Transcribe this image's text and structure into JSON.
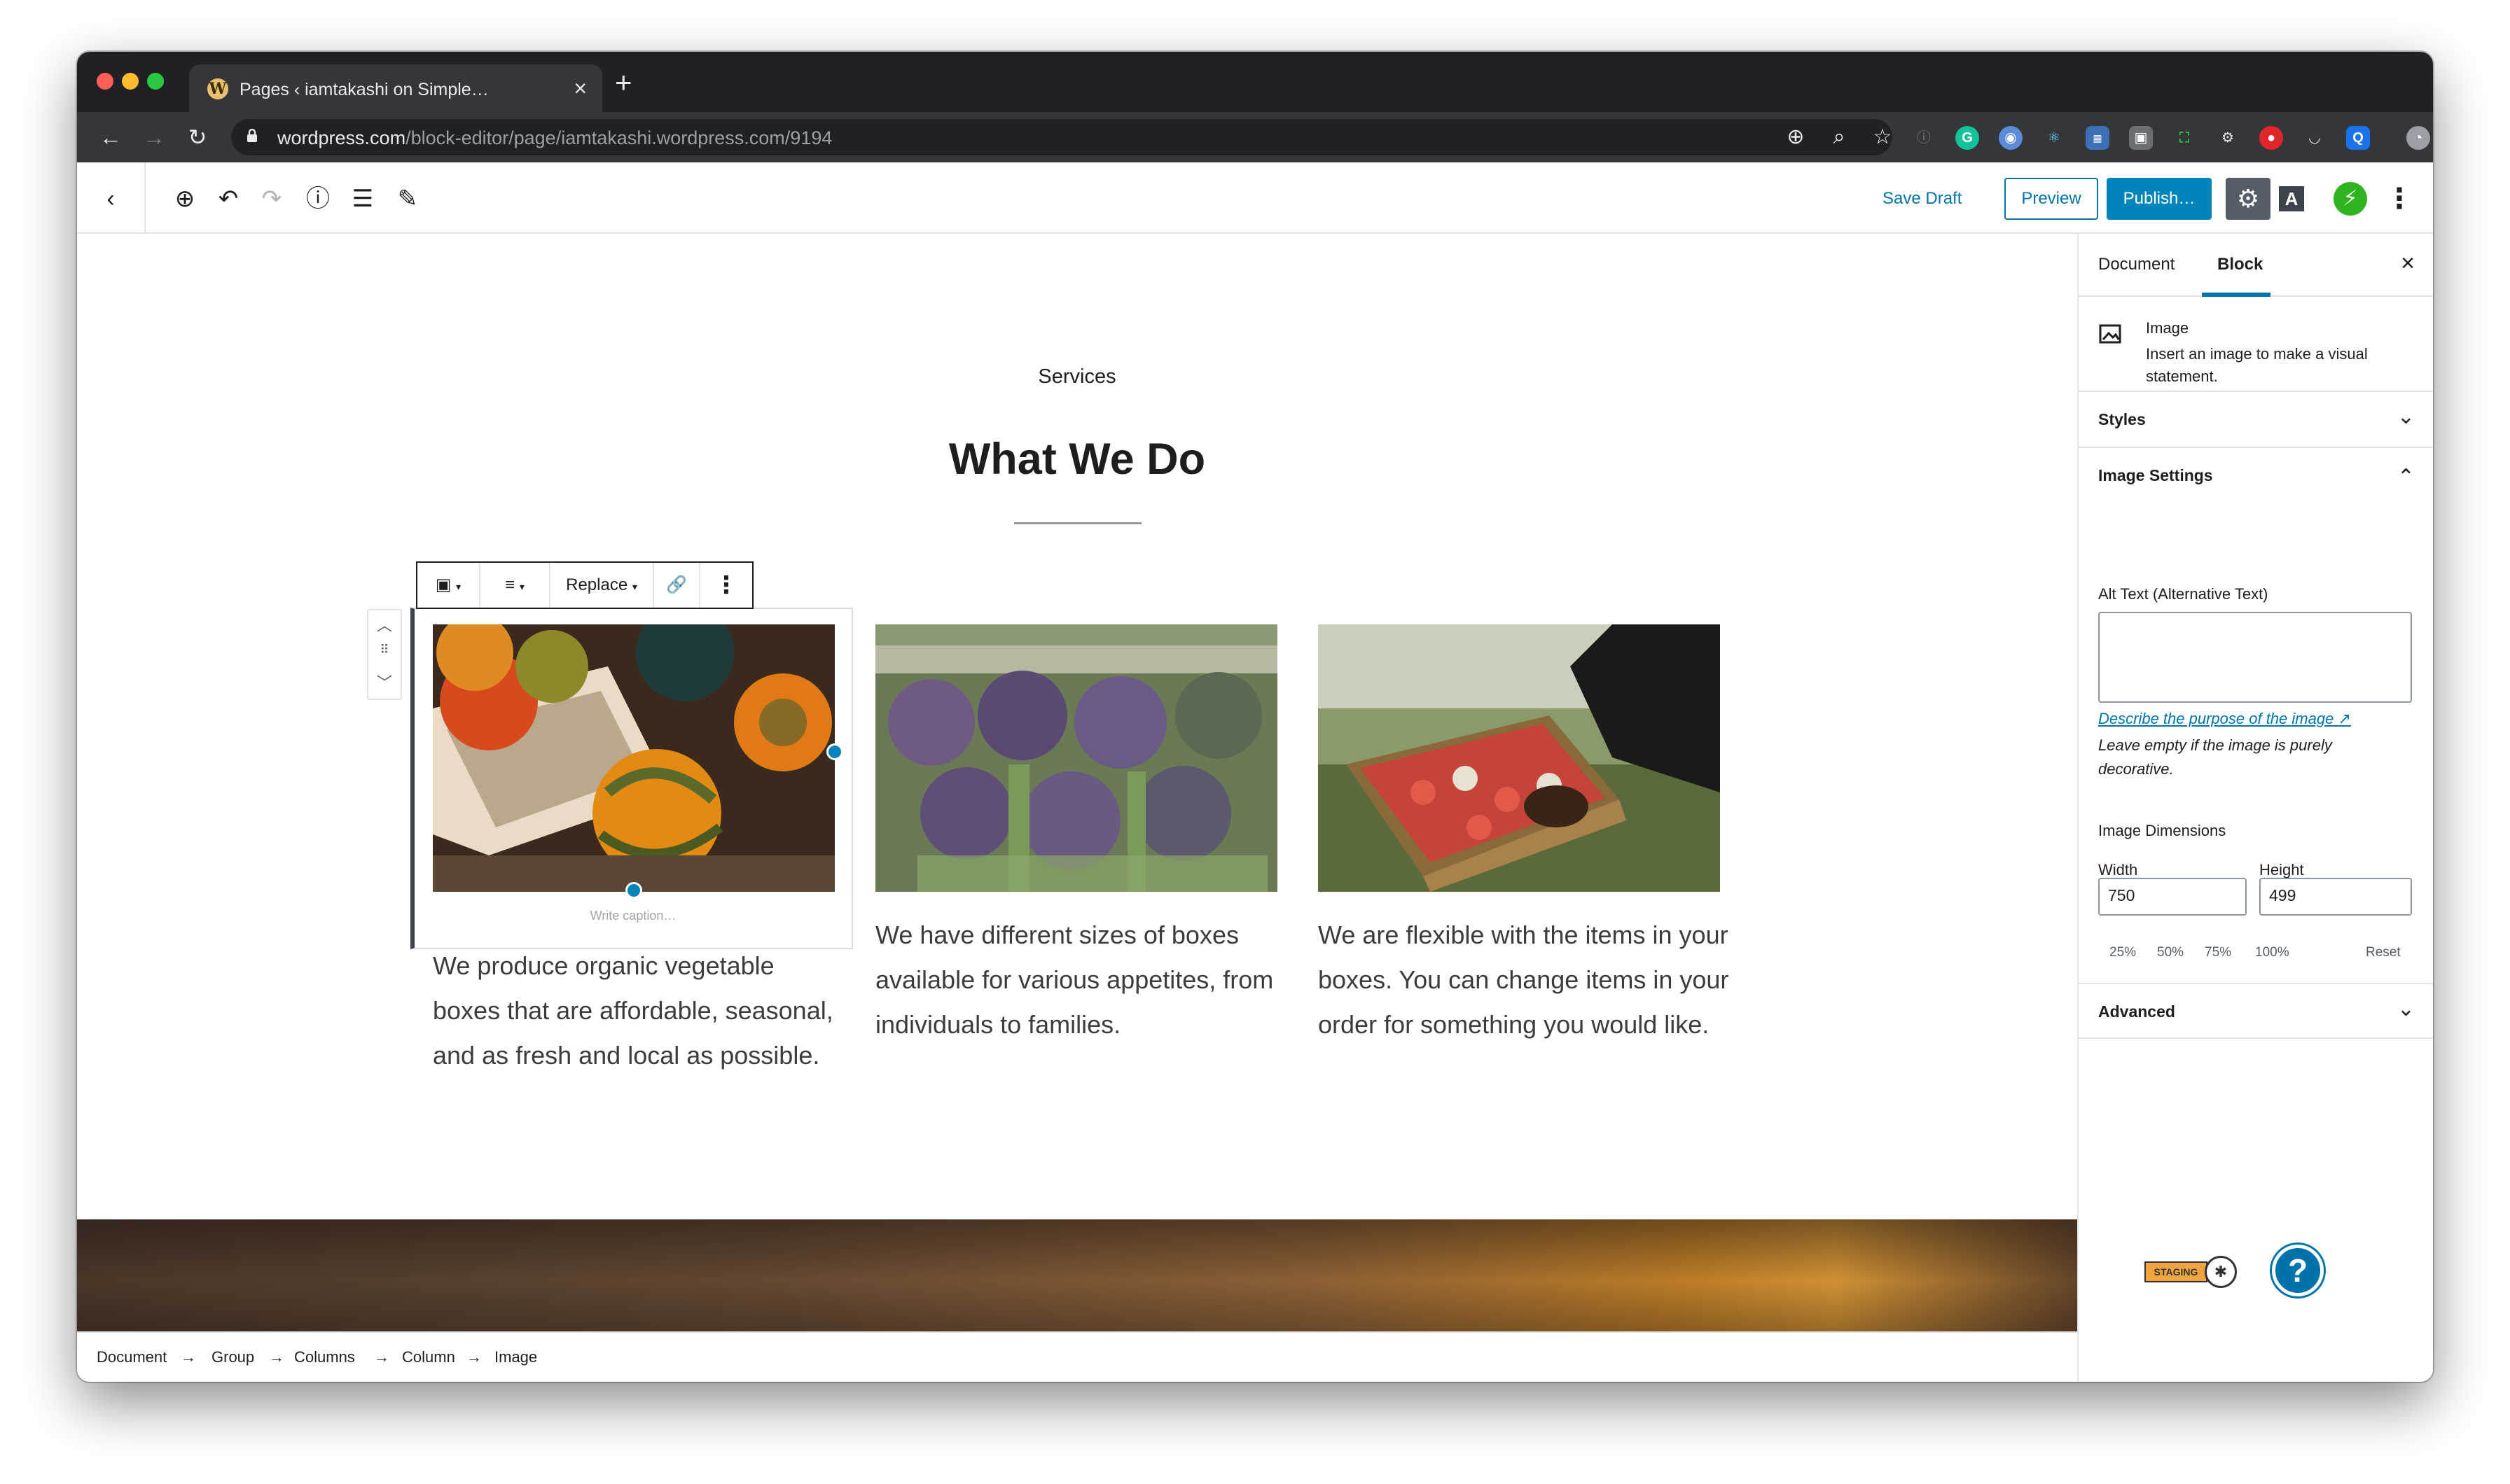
{
  "browser": {
    "tab_title": "Pages ‹ iamtakashi on Simple…",
    "tab_close": "×",
    "new_tab": "+",
    "url_host": "wordpress.com",
    "url_path": "/block-editor/page/iamtakashi.wordpress.com/9194"
  },
  "editor_header": {
    "save_draft": "Save Draft",
    "preview": "Preview",
    "publish": "Publish…"
  },
  "content": {
    "eyebrow": "Services",
    "heading": "What We Do",
    "block_toolbar": {
      "replace": "Replace"
    },
    "caption_placeholder": "Write caption…",
    "columns": [
      {
        "text": "We produce organic vegetable boxes that are affordable, seasonal, and as fresh and local as possible."
      },
      {
        "text": "We have different sizes of boxes available for various appetites, from individuals to families."
      },
      {
        "text": "We are flexible with the items in your boxes. You can change items in your order for something you would like."
      }
    ]
  },
  "breadcrumb": [
    "Document",
    "Group",
    "Columns",
    "Column",
    "Image"
  ],
  "breadcrumb_separator": "→",
  "sidebar": {
    "tabs": [
      "Document",
      "Block"
    ],
    "active_tab": "Block",
    "block_card": {
      "title": "Image",
      "description": "Insert an image to make a visual statement."
    },
    "panels": {
      "styles": "Styles",
      "image_settings": "Image Settings",
      "advanced": "Advanced"
    },
    "alt_text_label": "Alt Text (Alternative Text)",
    "alt_text_value": "",
    "help_link": "Describe the purpose of the image",
    "help_text": "Leave empty if the image is purely decorative.",
    "dimensions_label": "Image Dimensions",
    "width_label": "Width",
    "height_label": "Height",
    "width_value": "750",
    "height_value": "499",
    "percent_buttons": [
      "25%",
      "50%",
      "75%",
      "100%"
    ],
    "reset": "Reset"
  },
  "badges": {
    "staging": "STAGING",
    "help": "?"
  },
  "colors": {
    "accent": "#0073aa",
    "publish_bg": "#0085ba",
    "jetpack": "#2fb41f"
  }
}
